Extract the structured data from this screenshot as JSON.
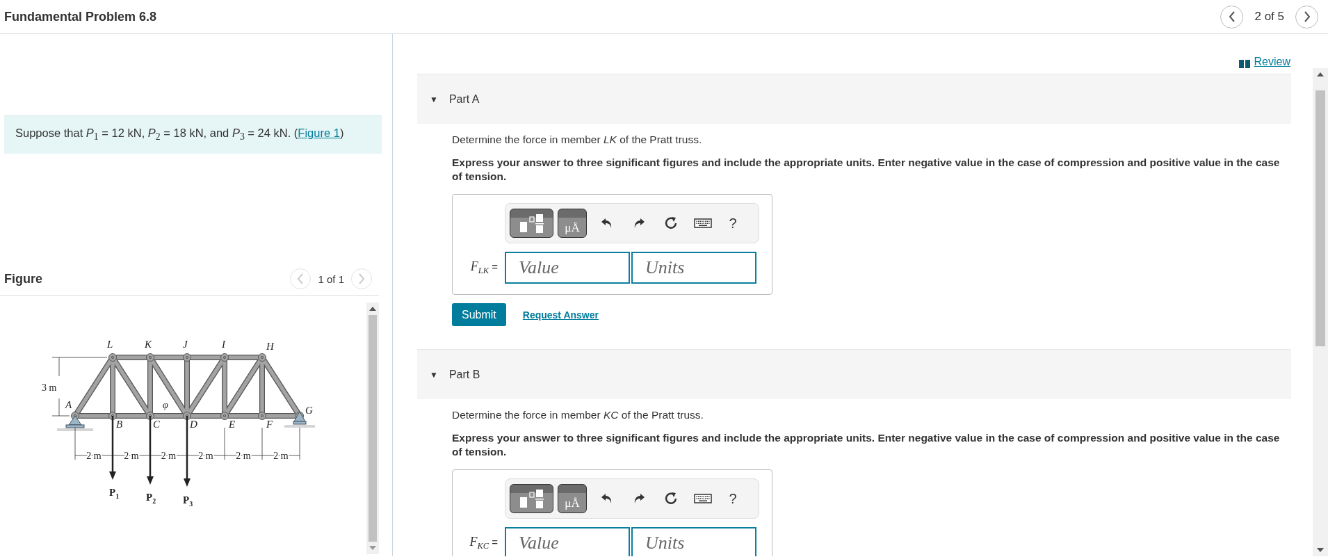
{
  "header": {
    "title": "Fundamental Problem 6.8",
    "pager": "2 of 5",
    "prev_disabled": false,
    "next_disabled": false
  },
  "intro": {
    "text": "Suppose that *P*$_{1}$ = 12 kN, *P*$_{2}$ = 18 kN, and *P*$_{3}$ = 24 kN. (",
    "link": "Figure 1",
    "after": ")"
  },
  "figure": {
    "title": "Figure",
    "pager": "1 of 1",
    "prev_disabled": true,
    "next_disabled": true,
    "node_labels": [
      "L",
      "K",
      "J",
      "I",
      "H",
      "A",
      "B",
      "C",
      "D",
      "E",
      "F",
      "G"
    ],
    "height_label": "3 m",
    "angle_label": "φ",
    "span_labels": [
      "2 m",
      "2 m",
      "2 m",
      "2 m",
      "2 m",
      "2 m"
    ],
    "loads": [
      {
        "letter": "P",
        "index": "1"
      },
      {
        "letter": "P",
        "index": "2"
      },
      {
        "letter": "P",
        "index": "3"
      }
    ]
  },
  "review": "Review",
  "parts": [
    {
      "label": "Part A",
      "caret": "▼",
      "expanded": true,
      "equals": "=",
      "question": "Determine the force in member *LK* of the Pratt truss.",
      "instructions": "Express your answer to three significant figures and include the appropriate units. Enter negative value in the case of compression and positive value in the case of tension.",
      "units_key": "μÅ",
      "help": "?",
      "symbol": "F",
      "subscript": "LK",
      "value_placeholder": "Value",
      "units_placeholder": "Units",
      "submit": "Submit",
      "request": "Request Answer"
    },
    {
      "label": "Part B",
      "caret": "▼",
      "expanded": true,
      "equals": "=",
      "question": "Determine the force in member *KC* of the Pratt truss.",
      "instructions": "Express your answer to three significant figures and include the appropriate units. Enter negative value in the case of compression and positive value in the case of tension.",
      "units_key": "μÅ",
      "help": "?",
      "symbol": "F",
      "subscript": "KC",
      "value_placeholder": "Value",
      "units_placeholder": "Units"
    }
  ]
}
